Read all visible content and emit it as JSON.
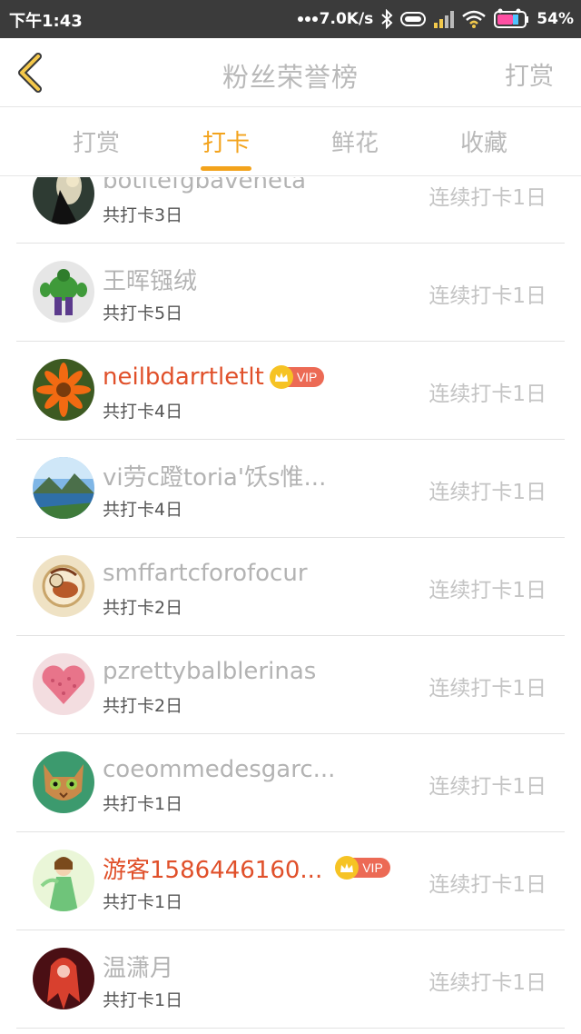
{
  "status_bar": {
    "time": "下午1:43",
    "network_speed": "7.0K/s",
    "battery": "54%",
    "icons": [
      "dots-icon",
      "bluetooth-icon",
      "battery-saver-icon",
      "signal-icon",
      "wifi-icon",
      "battery-icon"
    ]
  },
  "header": {
    "title": "粉丝荣誉榜",
    "right_action": "打赏",
    "back_icon": "chevron-left-icon"
  },
  "tabs": [
    {
      "label": "打赏",
      "active": false
    },
    {
      "label": "打卡",
      "active": true
    },
    {
      "label": "鲜花",
      "active": false
    },
    {
      "label": "收藏",
      "active": false
    }
  ],
  "colors": {
    "accent": "#f3a31c",
    "vip_name": "#e0502a",
    "muted_text": "#b3b3b3"
  },
  "list": [
    {
      "name": "botltefgbaveneta",
      "count": "共打卡3日",
      "streak": "连续打卡1日",
      "vip": false,
      "vip_label": ""
    },
    {
      "name": "王晖镪绒",
      "count": "共打卡5日",
      "streak": "连续打卡1日",
      "vip": false,
      "vip_label": ""
    },
    {
      "name": "neilbdarrtletlt",
      "count": "共打卡4日",
      "streak": "连续打卡1日",
      "vip": true,
      "vip_label": "VIP"
    },
    {
      "name": "vi劳c蹬toria'饫s惟...",
      "count": "共打卡4日",
      "streak": "连续打卡1日",
      "vip": false,
      "vip_label": ""
    },
    {
      "name": "smffartcforofocur",
      "count": "共打卡2日",
      "streak": "连续打卡1日",
      "vip": false,
      "vip_label": ""
    },
    {
      "name": "pzrettybalblerinas",
      "count": "共打卡2日",
      "streak": "连续打卡1日",
      "vip": false,
      "vip_label": ""
    },
    {
      "name": "coeommedesgarc...",
      "count": "共打卡1日",
      "streak": "连续打卡1日",
      "vip": false,
      "vip_label": ""
    },
    {
      "name": "游客1586446160...",
      "count": "共打卡1日",
      "streak": "连续打卡1日",
      "vip": true,
      "vip_label": "VIP"
    },
    {
      "name": "温潇月",
      "count": "共打卡1日",
      "streak": "连续打卡1日",
      "vip": false,
      "vip_label": ""
    }
  ]
}
